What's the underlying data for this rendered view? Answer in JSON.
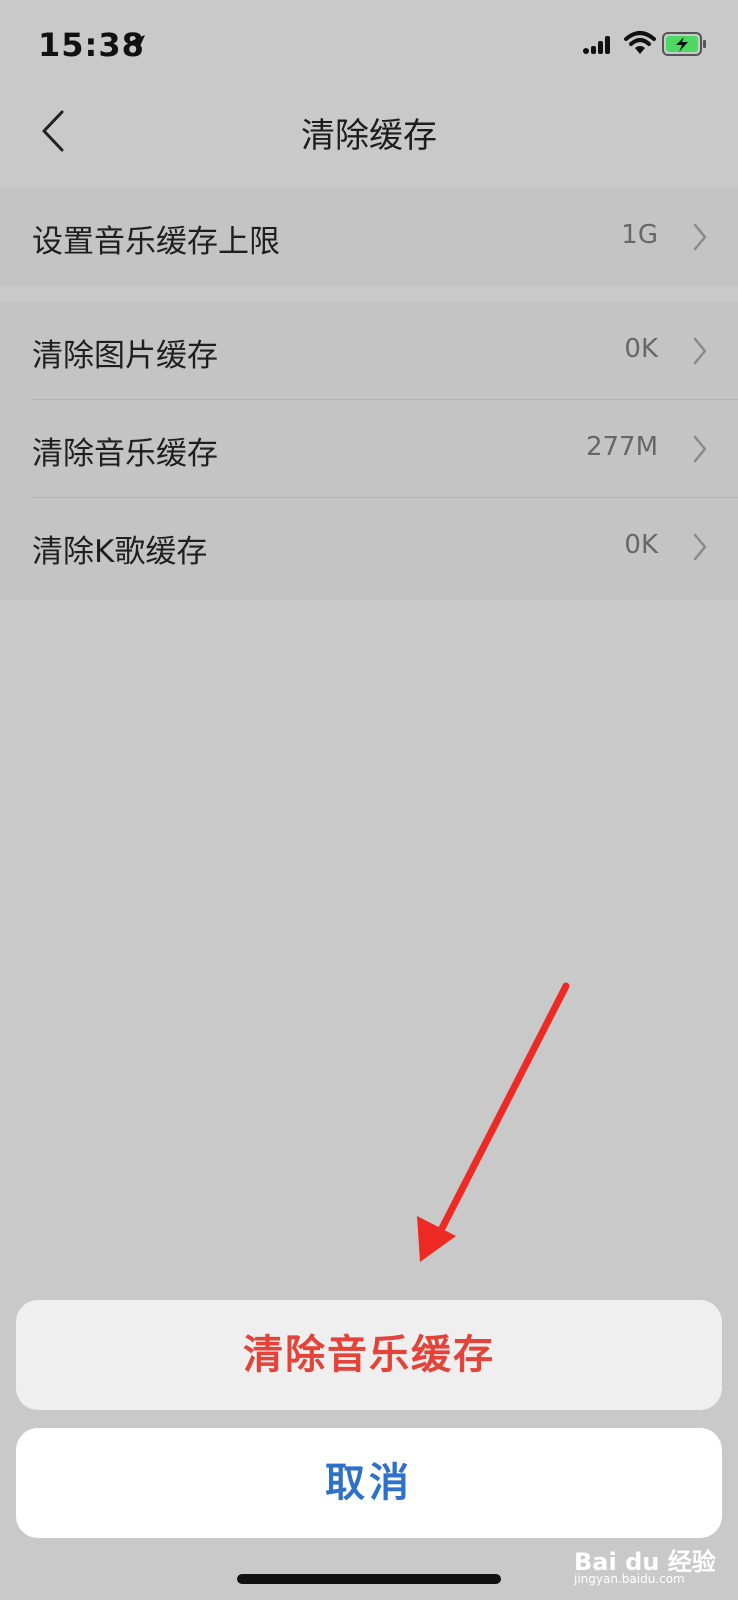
{
  "status_bar": {
    "time": "15:38",
    "icons": [
      "location-arrow-icon",
      "signal-icon",
      "wifi-icon",
      "battery-charging-icon"
    ]
  },
  "nav": {
    "title": "清除缓存",
    "back_icon": "chevron-left-icon"
  },
  "settings": [
    {
      "label": "设置音乐缓存上限",
      "value": "1G"
    },
    {
      "label": "清除图片缓存",
      "value": "0K"
    },
    {
      "label": "清除音乐缓存",
      "value": "277M"
    },
    {
      "label": "清除K歌缓存",
      "value": "0K"
    }
  ],
  "action_sheet": {
    "confirm_label": "清除音乐缓存",
    "cancel_label": "取消"
  },
  "watermark": {
    "text": "Bai du 经验",
    "sub": "jingyan.baidu.com"
  },
  "colors": {
    "background": "#c9c9c9",
    "destructive": "#e4433a",
    "cancel": "#2d72c8",
    "annotation_arrow": "#ee2a24",
    "battery": "#4cd964"
  }
}
